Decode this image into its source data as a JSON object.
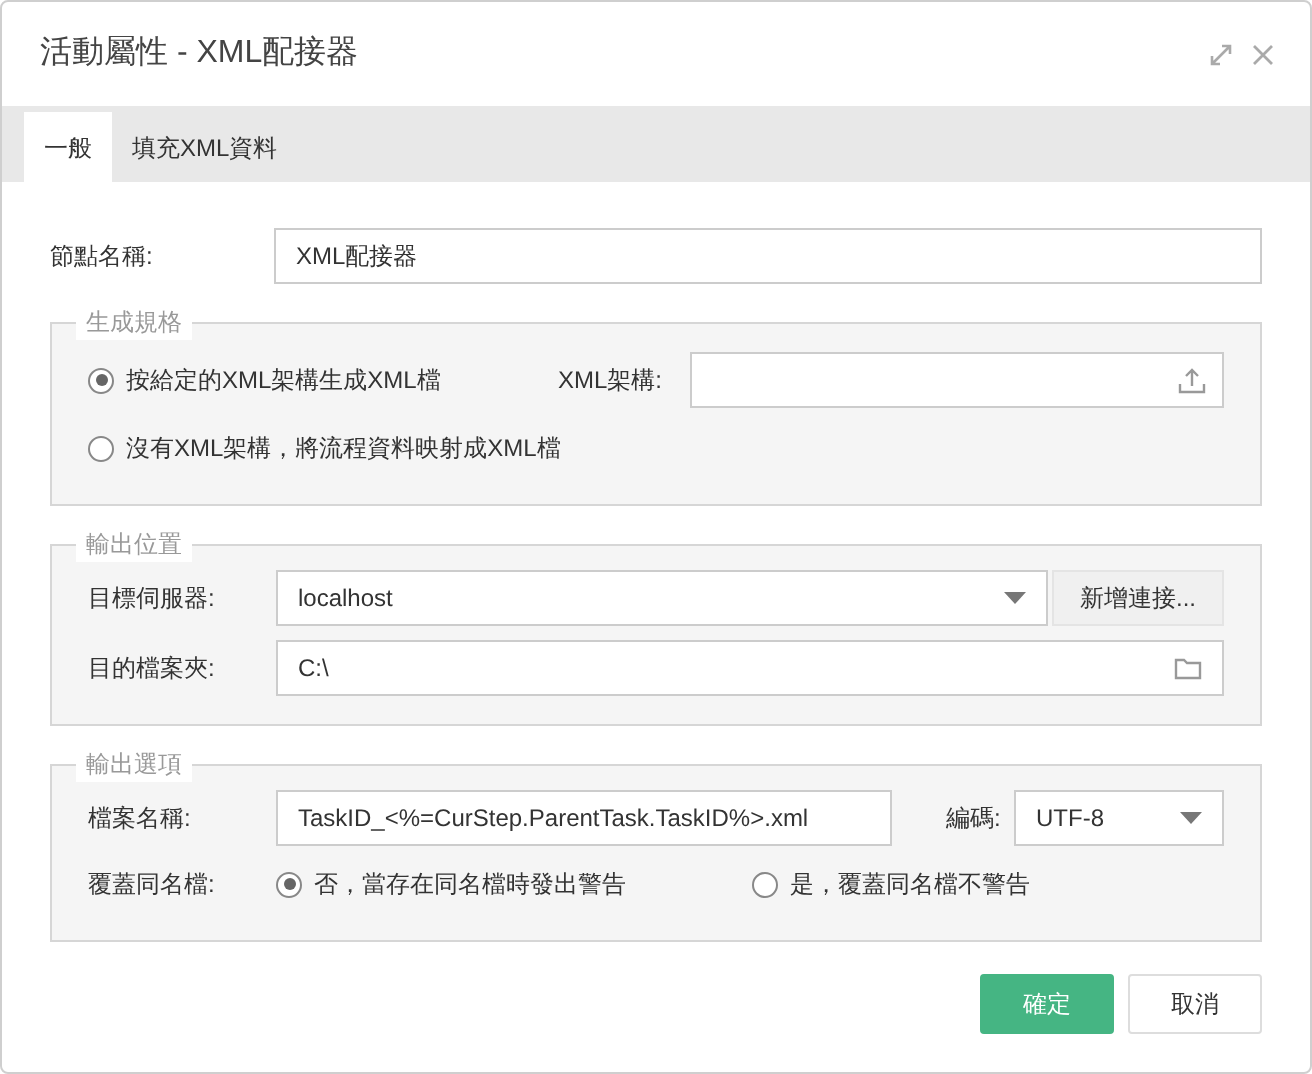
{
  "window": {
    "title": "活動屬性 - XML配接器"
  },
  "tabs": [
    {
      "label": "一般",
      "selected": true
    },
    {
      "label": "填充XML資料",
      "selected": false
    }
  ],
  "node_name": {
    "label": "節點名稱:",
    "value": "XML配接器"
  },
  "generation": {
    "legend": "生成規格",
    "options": [
      {
        "label": "按給定的XML架構生成XML檔",
        "selected": true
      },
      {
        "label": "沒有XML架構，將流程資料映射成XML檔",
        "selected": false
      }
    ],
    "schema_field": {
      "label": "XML架構:"
    }
  },
  "output_location": {
    "legend": "輸出位置",
    "server": {
      "label": "目標伺服器:",
      "value": "localhost"
    },
    "new_connection_button": "新增連接...",
    "folder": {
      "label": "目的檔案夾:",
      "value": "C:\\"
    }
  },
  "output_options": {
    "legend": "輸出選項",
    "file_name": {
      "label": "檔案名稱:",
      "value": "TaskID_<%=CurStep.ParentTask.TaskID%>.xml"
    },
    "encoding": {
      "label": "編碼:",
      "value": "UTF-8"
    },
    "overwrite": {
      "label": "覆蓋同名檔:",
      "options": [
        {
          "label": "否，當存在同名檔時發出警告",
          "selected": true
        },
        {
          "label": "是，覆蓋同名檔不警告",
          "selected": false
        }
      ]
    }
  },
  "buttons": [
    {
      "label": "確定",
      "kind": "primary"
    },
    {
      "label": "取消",
      "kind": "default"
    }
  ]
}
